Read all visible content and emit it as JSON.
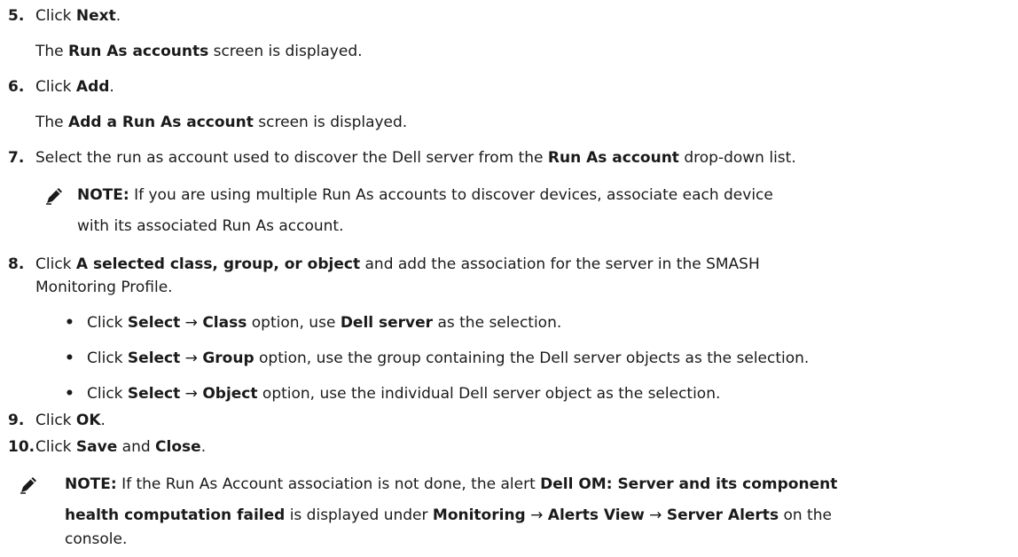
{
  "steps": [
    {
      "num": "5.",
      "pre": "Click ",
      "b1": "Next",
      "post": "."
    },
    {
      "pre": "The ",
      "b1": "Run As accounts",
      "post": " screen is displayed."
    },
    {
      "num": "6.",
      "pre": "Click ",
      "b1": "Add",
      "post": "."
    },
    {
      "pre": "The ",
      "b1": "Add a Run As account",
      "post": " screen is displayed."
    },
    {
      "num": "7.",
      "pre": "Select the run as account used to discover the Dell server from the ",
      "b1": "Run As account",
      "post": " drop-down list."
    }
  ],
  "note1": {
    "label": "NOTE:",
    "line1": " If you are using multiple Run As accounts to discover devices, associate each device",
    "line2": "with its associated Run As account."
  },
  "step8": {
    "num": "8.",
    "pre": "Click ",
    "b1": "A selected class, group, or object",
    "post": " and add the association for the server in the SMASH",
    "line2": "Monitoring Profile."
  },
  "bullets": [
    {
      "pre": "Click ",
      "b1": "Select",
      "arrow": " → ",
      "b2": "Class",
      "mid": " option, use ",
      "b3": "Dell server",
      "post": " as the selection."
    },
    {
      "pre": "Click ",
      "b1": "Select",
      "arrow": " → ",
      "b2": "Group",
      "post": " option, use the group containing the Dell server objects as the selection."
    },
    {
      "pre": "Click ",
      "b1": "Select",
      "arrow": " → ",
      "b2": "Object",
      "post": " option, use the individual Dell server object as the selection."
    }
  ],
  "step9": {
    "num": "9.",
    "pre": "Click ",
    "b1": "OK",
    "post": "."
  },
  "step10": {
    "num": "10.",
    "pre": "Click ",
    "b1": "Save",
    "mid": " and ",
    "b2": "Close",
    "post": "."
  },
  "note2": {
    "label": "NOTE:",
    "l1a": " If the Run As Account association is not done, the alert ",
    "l1b": "Dell OM: Server and its component",
    "l2a": "health computation failed",
    "l2b": " is displayed under ",
    "l2c": "Monitoring",
    "l2d": " → ",
    "l2e": "Alerts View",
    "l2f": " → ",
    "l2g": "Server Alerts",
    "l2h": " on the",
    "l3": "console."
  }
}
